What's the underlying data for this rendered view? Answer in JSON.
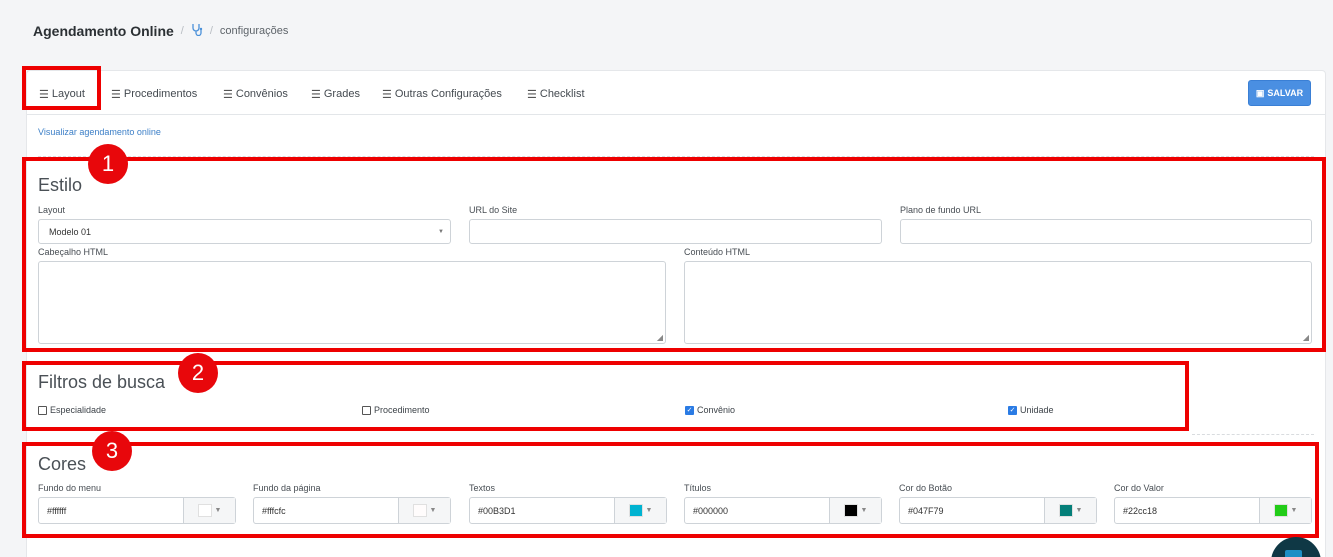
{
  "breadcrumb": {
    "title": "Agendamento Online",
    "separator": "/",
    "icon": "stethoscope-icon",
    "current": "configurações"
  },
  "tabs": [
    {
      "label": "Layout",
      "active": true,
      "icon": "list-icon"
    },
    {
      "label": "Procedimentos",
      "icon": "list-icon"
    },
    {
      "label": "Convênios",
      "icon": "list-icon"
    },
    {
      "label": "Grades",
      "icon": "list-icon"
    },
    {
      "label": "Outras Configurações",
      "icon": "list-icon"
    },
    {
      "label": "Checklist",
      "icon": "list-icon"
    }
  ],
  "save_button": {
    "label": "SALVAR",
    "icon": "floppy-icon"
  },
  "view_link": "Visualizar agendamento online",
  "annotations": [
    "1",
    "2",
    "3"
  ],
  "estilo": {
    "heading": "Estilo",
    "layout_label": "Layout",
    "layout_value": "Modelo 01",
    "url_label": "URL do Site",
    "url_value": "",
    "bg_label": "Plano de fundo URL",
    "bg_value": "",
    "header_label": "Cabeçalho HTML",
    "content_label": "Conteúdo HTML"
  },
  "filtros": {
    "heading": "Filtros de busca",
    "options": [
      {
        "label": "Especialidade",
        "checked": false
      },
      {
        "label": "Procedimento",
        "checked": false
      },
      {
        "label": "Convênio",
        "checked": true
      },
      {
        "label": "Unidade",
        "checked": true
      }
    ]
  },
  "cores": {
    "heading": "Cores",
    "fields": [
      {
        "label": "Fundo do menu",
        "value": "#ffffff",
        "swatch": "#ffffff"
      },
      {
        "label": "Fundo da página",
        "value": "#fffcfc",
        "swatch": "#fffcfc"
      },
      {
        "label": "Textos",
        "value": "#00B3D1",
        "swatch": "#00B3D1"
      },
      {
        "label": "Títulos",
        "value": "#000000",
        "swatch": "#000000"
      },
      {
        "label": "Cor do Botão",
        "value": "#047F79",
        "swatch": "#047F79"
      },
      {
        "label": "Cor do Valor",
        "value": "#22cc18",
        "swatch": "#22cc18"
      }
    ]
  },
  "colors": {
    "accent": "#4a8fe2",
    "highlight": "#ee0000"
  }
}
